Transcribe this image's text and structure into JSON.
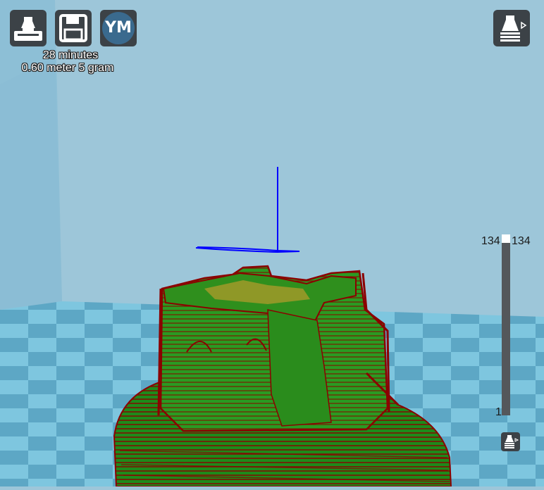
{
  "toolbar": {
    "load_icon": "load-file-icon",
    "save_icon": "save-icon",
    "account_label": "YM"
  },
  "print_info": {
    "time": "28 minutes",
    "usage": "0.60 meter 5 gram"
  },
  "view_mode": {
    "icon": "view-mode-icon"
  },
  "layer_slider": {
    "max_left": "134",
    "max_right": "134",
    "min": "1",
    "position_fraction": 1.0
  },
  "colors": {
    "background": "#9dc6d9",
    "floor_light": "#7cc6df",
    "floor_dark": "#5aa5c4",
    "outer_wall": "#8b0000",
    "inner_fill": "#1e8a1a",
    "infill": "#b8a82a",
    "travel_path": "#0000ff",
    "button_bg": "#3c4247",
    "slider_track": "#54575b"
  }
}
